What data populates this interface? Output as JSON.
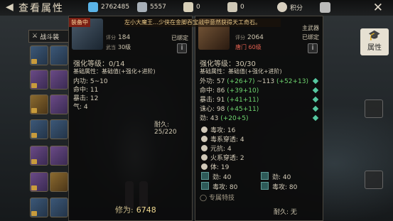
{
  "topbar": {
    "title": "查看属性",
    "currencies": [
      {
        "icon": "diamond-currency-icon",
        "value": "2762485",
        "color": "#7fd0ff"
      },
      {
        "icon": "silver-currency-icon",
        "value": "5557",
        "color": "#c0c8d0"
      },
      {
        "icon": "bell-currency-icon",
        "value": "0",
        "color": "#e0d8c0"
      },
      {
        "icon": "cloud-currency-icon",
        "value": "0",
        "color": "#e0d8c0"
      },
      {
        "icon": "points-icon",
        "value": "积分",
        "color": "#e0d8c0"
      }
    ]
  },
  "left_tabs": {
    "battle_gear": "战斗装"
  },
  "banner": "左小大魔王…少侠在金脚吞宝战中意然获得天工奇石。",
  "equipped_item": {
    "badge": "装备中",
    "score_label": "评分",
    "score": "184",
    "type_label": "武当",
    "level_label": "30级",
    "bound": "已绑定",
    "refine": "强化等级：0/14",
    "base_attr": "基础属性：基础值(+强化+进阶)",
    "lines": [
      "内功: 5~10",
      "命中: 11",
      "暴击: 12",
      "气: 4"
    ],
    "durability_label": "耐久:",
    "durability": "25/220"
  },
  "compare_item": {
    "slot": "主武器",
    "score_label": "评分",
    "score": "2064",
    "type_label": "唐门",
    "level_label": "60级",
    "bound": "已绑定",
    "refine": "强化等级：30/30",
    "base_attr": "基础属性：基础值(+强化+进阶)",
    "lines": [
      {
        "text": "外功: 57 ",
        "bonus": "(+26+7)",
        "rest": " ~113 ",
        "bonus2": "(+52+13)"
      },
      {
        "text": "命中: 86 ",
        "bonus": "(+39+10)",
        "rest": "",
        "bonus2": ""
      },
      {
        "text": "暴击: 91 ",
        "bonus": "(+41+11)",
        "rest": "",
        "bonus2": ""
      },
      {
        "text": "诛心: 98 ",
        "bonus": "(+45+11)",
        "rest": "",
        "bonus2": ""
      },
      {
        "text": "劲: 43 ",
        "bonus": "(+20+5)",
        "rest": "",
        "bonus2": ""
      }
    ],
    "gem_lines": [
      "毒攻: 16",
      "毒系穿透: 4",
      "元抗: 4",
      "火系穿透: 2",
      "体: 19"
    ],
    "small_gems": [
      "劲: 40",
      "劲: 40",
      "毒攻: 80",
      "毒攻: 80"
    ],
    "special": "专属特技",
    "durability_label": "耐久:",
    "durability": "无"
  },
  "power": {
    "label": "修为:",
    "value": "6748"
  },
  "right": {
    "attr_button": "属性"
  }
}
